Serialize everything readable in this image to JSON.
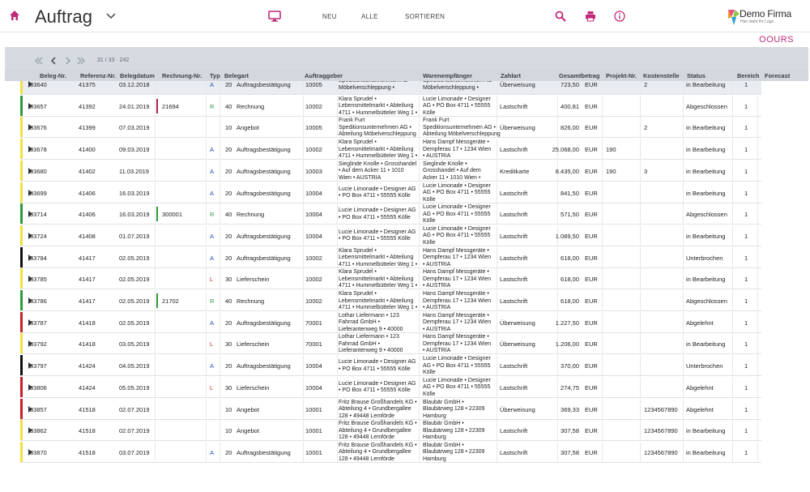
{
  "header": {
    "title": "Auftrag",
    "nav": {
      "neu": "NEU",
      "alle": "ALLE",
      "sortieren": "SORTIEREN"
    },
    "logo_name": "Demo Firma",
    "logo_tagline": "Hier steht Ihr Logo"
  },
  "brand": "OOURS",
  "pager": {
    "text": "31 / 33 · 242"
  },
  "columns": [
    "Beleg-Nr.",
    "Referenz-Nr.",
    "Belegdatum",
    "Rechnung-Nr.",
    "Typ",
    "Belegart",
    "Auftraggeber",
    "Warenempfänger",
    "Zahlart",
    "Gesamtbetrag",
    "Projekt-Nr.",
    "Kostenstelle",
    "Status",
    "Bereich",
    "Forecast"
  ],
  "colors": {
    "accent": "#c02a78",
    "blue": "#1a4fbf",
    "green": "#2e9a3a",
    "red": "#c8202a",
    "yellow": "#f0e040",
    "black": "#111111"
  },
  "rows": [
    {
      "beleg": "33640",
      "ref": "41375",
      "datum": "03.12.2018",
      "rechnung": "",
      "typ": "A",
      "nr": "20",
      "art": "Auftragsbestätigung",
      "kunde": "10005",
      "auftraggeber": [
        "Speditionsunternehmen AG •",
        "Möbelverschleppung •"
      ],
      "empf": [
        "Speditionsunternehmen AG •",
        "Möbelverschleppung •"
      ],
      "zahlart": "Überweisung",
      "betrag": "723,50",
      "waehrung": "EUR",
      "projekt": "",
      "kst": "2",
      "status": "in Bearbeitung",
      "bereich": "1",
      "bar": "yellow"
    },
    {
      "beleg": "33657",
      "ref": "41392",
      "datum": "24.01.2019",
      "rechnung": "21694",
      "typ": "R",
      "nr": "40",
      "art": "Rechnung",
      "kunde": "10002",
      "auftraggeber": [
        "Klara Sprudel •",
        "Lebensmittelmarkt • Abteilung",
        "4711 • Hummelbütteler Weg 1 •"
      ],
      "empf": [
        "Lucie Limonade • Designer",
        "AG • PO Box 4711 • 55555",
        "Kölle"
      ],
      "zahlart": "Lastschrift",
      "betrag": "400,81",
      "waehrung": "EUR",
      "projekt": "",
      "kst": "",
      "status": "Abgeschlossen",
      "bereich": "1",
      "bar": "green"
    },
    {
      "beleg": "33676",
      "ref": "41399",
      "datum": "07.03.2019",
      "rechnung": "",
      "typ": "",
      "nr": "10",
      "art": "Angebot",
      "kunde": "10005",
      "auftraggeber": [
        "Frank Furt",
        "Speditionsunternehmen AG •",
        "Abteilung Möbelverschleppung"
      ],
      "empf": [
        "Frank Furt",
        "Speditionsunternehmen AG •",
        "Abteilung Möbelverschleppung"
      ],
      "zahlart": "Überweisung",
      "betrag": "826,00",
      "waehrung": "EUR",
      "projekt": "",
      "kst": "2",
      "status": "in Bearbeitung",
      "bereich": "1",
      "bar": "yellow"
    },
    {
      "beleg": "33678",
      "ref": "41400",
      "datum": "09.03.2019",
      "rechnung": "",
      "typ": "A",
      "nr": "20",
      "art": "Auftragsbestätigung",
      "kunde": "10002",
      "auftraggeber": [
        "Klara Sprudel •",
        "Lebensmittelmarkt • Abteilung",
        "4711 • Hummelbütteler Weg 1 •"
      ],
      "empf": [
        "Hans Dampf Messgeräte •",
        "Dempferau 17 • 1234 Wien",
        "• AUSTRIA"
      ],
      "zahlart": "Lastschrift",
      "betrag": "25.068,00",
      "waehrung": "EUR",
      "projekt": "190",
      "kst": "",
      "status": "in Bearbeitung",
      "bereich": "1",
      "bar": "yellow"
    },
    {
      "beleg": "33680",
      "ref": "41402",
      "datum": "11.03.2019",
      "rechnung": "",
      "typ": "A",
      "nr": "20",
      "art": "Auftragsbestätigung",
      "kunde": "10003",
      "auftraggeber": [
        "Sieglinde Knolle • Grosshandel",
        "• Auf dem Acker 11 • 1010",
        "Wien • AUSTRIA"
      ],
      "empf": [
        "Sieglinde Knolle •",
        "Grosshandel • Auf dem",
        "Acker 11 • 1010 Wien •"
      ],
      "zahlart": "Kreditkarte",
      "betrag": "8.435,00",
      "waehrung": "EUR",
      "projekt": "190",
      "kst": "3",
      "status": "in Bearbeitung",
      "bereich": "1",
      "bar": "yellow"
    },
    {
      "beleg": "33699",
      "ref": "41406",
      "datum": "16.03.2019",
      "rechnung": "",
      "typ": "A",
      "nr": "20",
      "art": "Auftragsbestätigung",
      "kunde": "10004",
      "auftraggeber": [
        "Lucie Limonade • Designer AG",
        "• PO Box 4711 • 55555 Kölle"
      ],
      "empf": [
        "Lucie Limonade • Designer",
        "AG • PO Box 4711 • 55555",
        "Kölle"
      ],
      "zahlart": "Lastschrift",
      "betrag": "841,50",
      "waehrung": "EUR",
      "projekt": "",
      "kst": "",
      "status": "in Bearbeitung",
      "bereich": "1",
      "bar": "yellow"
    },
    {
      "beleg": "33714",
      "ref": "41406",
      "datum": "16.03.2019",
      "rechnung": "300001",
      "typ": "R",
      "nr": "40",
      "art": "Rechnung",
      "kunde": "10004",
      "auftraggeber": [
        "Lucie Limonade • Designer AG",
        "• PO Box 4711 • 55555 Kölle"
      ],
      "empf": [
        "Lucie Limonade • Designer",
        "AG • PO Box 4711 • 55555",
        "Kölle"
      ],
      "zahlart": "Lastschrift",
      "betrag": "571,50",
      "waehrung": "EUR",
      "projekt": "",
      "kst": "",
      "status": "Abgeschlossen",
      "bereich": "1",
      "bar": "green"
    },
    {
      "beleg": "33724",
      "ref": "41408",
      "datum": "01.07.2019",
      "rechnung": "",
      "typ": "A",
      "nr": "20",
      "art": "Auftragsbestätigung",
      "kunde": "10004",
      "auftraggeber": [
        "Lucie Limonade • Designer AG",
        "• PO Box 4711 • 55555 Kölle"
      ],
      "empf": [
        "Lucie Limonade • Designer",
        "AG • PO Box 4711 • 55555",
        "Kölle"
      ],
      "zahlart": "Lastschrift",
      "betrag": "1.089,50",
      "waehrung": "EUR",
      "projekt": "",
      "kst": "",
      "status": "in Bearbeitung",
      "bereich": "1",
      "bar": "yellow"
    },
    {
      "beleg": "33784",
      "ref": "41417",
      "datum": "02.05.2019",
      "rechnung": "",
      "typ": "A",
      "nr": "20",
      "art": "Auftragsbestätigung",
      "kunde": "10002",
      "auftraggeber": [
        "Klara Sprudel •",
        "Lebensmittelmarkt • Abteilung",
        "4711 • Hummelbütteler Weg 1 •"
      ],
      "empf": [
        "Hans Dampf Messgeräte •",
        "Dempferau 17 • 1234 Wien",
        "• AUSTRIA"
      ],
      "zahlart": "Lastschrift",
      "betrag": "618,00",
      "waehrung": "EUR",
      "projekt": "",
      "kst": "",
      "status": "Unterbrochen",
      "bereich": "1",
      "bar": "black"
    },
    {
      "beleg": "33785",
      "ref": "41417",
      "datum": "02.05.2019",
      "rechnung": "",
      "typ": "L",
      "nr": "30",
      "art": "Lieferschein",
      "kunde": "10002",
      "auftraggeber": [
        "Klara Sprudel •",
        "Lebensmittelmarkt • Abteilung",
        "4711 • Hummelbütteler Weg 1 •"
      ],
      "empf": [
        "Hans Dampf Messgeräte •",
        "Dempferau 17 • 1234 Wien",
        "• AUSTRIA"
      ],
      "zahlart": "Lastschrift",
      "betrag": "618,00",
      "waehrung": "EUR",
      "projekt": "",
      "kst": "",
      "status": "in Bearbeitung",
      "bereich": "1",
      "bar": "yellow"
    },
    {
      "beleg": "33786",
      "ref": "41417",
      "datum": "02.05.2019",
      "rechnung": "21702",
      "typ": "R",
      "nr": "40",
      "art": "Rechnung",
      "kunde": "10002",
      "auftraggeber": [
        "Klara Sprudel •",
        "Lebensmittelmarkt • Abteilung",
        "4711 • Hummelbütteler Weg 1 •"
      ],
      "empf": [
        "Hans Dampf Messgeräte •",
        "Dempferau 17 • 1234 Wien",
        "• AUSTRIA"
      ],
      "zahlart": "Lastschrift",
      "betrag": "618,00",
      "waehrung": "EUR",
      "projekt": "",
      "kst": "",
      "status": "Abgeschlossen",
      "bereich": "1",
      "bar": "green"
    },
    {
      "beleg": "33787",
      "ref": "41418",
      "datum": "02.05.2019",
      "rechnung": "",
      "typ": "A",
      "nr": "20",
      "art": "Auftragsbestätigung",
      "kunde": "70001",
      "auftraggeber": [
        "Lothar Liefermann • 123",
        "Fahrrad GmbH •",
        "Lieferantenweg 9 • 40000"
      ],
      "empf": [
        "Hans Dampf Messgeräte •",
        "Dempferau 17 • 1234 Wien",
        "• AUSTRIA"
      ],
      "zahlart": "Überweisung",
      "betrag": "1.227,50",
      "waehrung": "EUR",
      "projekt": "",
      "kst": "",
      "status": "Abgelehnt",
      "bereich": "1",
      "bar": "red"
    },
    {
      "beleg": "33792",
      "ref": "41418",
      "datum": "03.05.2019",
      "rechnung": "",
      "typ": "L",
      "nr": "30",
      "art": "Lieferschein",
      "kunde": "70001",
      "auftraggeber": [
        "Lothar Liefermann • 123",
        "Fahrrad GmbH •",
        "Lieferantenweg 9 • 40000"
      ],
      "empf": [
        "Hans Dampf Messgeräte •",
        "Dempferau 17 • 1234 Wien",
        "• AUSTRIA"
      ],
      "zahlart": "Überweisung",
      "betrag": "1.206,00",
      "waehrung": "EUR",
      "projekt": "",
      "kst": "",
      "status": "in Bearbeitung",
      "bereich": "1",
      "bar": "yellow"
    },
    {
      "beleg": "33797",
      "ref": "41424",
      "datum": "04.05.2019",
      "rechnung": "",
      "typ": "A",
      "nr": "20",
      "art": "Auftragsbestätigung",
      "kunde": "10004",
      "auftraggeber": [
        "Lucie Limonade • Designer AG",
        "• PO Box 4711 • 55555 Kölle"
      ],
      "empf": [
        "Lucie Limonade • Designer",
        "AG • PO Box 4711 • 55555",
        "Kölle"
      ],
      "zahlart": "Lastschrift",
      "betrag": "370,00",
      "waehrung": "EUR",
      "projekt": "",
      "kst": "",
      "status": "Unterbrochen",
      "bereich": "1",
      "bar": "black"
    },
    {
      "beleg": "33806",
      "ref": "41424",
      "datum": "05.05.2019",
      "rechnung": "",
      "typ": "L",
      "nr": "30",
      "art": "Lieferschein",
      "kunde": "10004",
      "auftraggeber": [
        "Lucie Limonade • Designer AG",
        "• PO Box 4711 • 55555 Kölle"
      ],
      "empf": [
        "Lucie Limonade • Designer",
        "AG • PO Box 4711 • 55555",
        "Kölle"
      ],
      "zahlart": "Lastschrift",
      "betrag": "274,75",
      "waehrung": "EUR",
      "projekt": "",
      "kst": "",
      "status": "Abgelehnt",
      "bereich": "1",
      "bar": "red"
    },
    {
      "beleg": "33857",
      "ref": "41518",
      "datum": "02.07.2019",
      "rechnung": "",
      "typ": "",
      "nr": "10",
      "art": "Angebot",
      "kunde": "10001",
      "auftraggeber": [
        "Fritz Brause Großhandels KG •",
        "Abteilung 4 • Grundbergallee",
        "128 • 49448 Lemförde"
      ],
      "empf": [
        "Blaubär GmbH •",
        "Blaubärweg 128 • 22309",
        "Hamburg"
      ],
      "zahlart": "Überweisung",
      "betrag": "369,33",
      "waehrung": "EUR",
      "projekt": "",
      "kst": "1234567890",
      "status": "Abgelehnt",
      "bereich": "1",
      "bar": "red"
    },
    {
      "beleg": "33862",
      "ref": "41518",
      "datum": "02.07.2019",
      "rechnung": "",
      "typ": "",
      "nr": "10",
      "art": "Angebot",
      "kunde": "10001",
      "auftraggeber": [
        "Fritz Brause Großhandels KG •",
        "Abteilung 4 • Grundbergallee",
        "128 • 49448 Lemförde"
      ],
      "empf": [
        "Blaubär GmbH •",
        "Blaubärweg 128 • 22309",
        "Hamburg"
      ],
      "zahlart": "Lastschrift",
      "betrag": "307,58",
      "waehrung": "EUR",
      "projekt": "",
      "kst": "1234567890",
      "status": "in Bearbeitung",
      "bereich": "1",
      "bar": "yellow"
    },
    {
      "beleg": "33870",
      "ref": "41518",
      "datum": "03.07.2019",
      "rechnung": "",
      "typ": "A",
      "nr": "20",
      "art": "Auftragsbestätigung",
      "kunde": "10001",
      "auftraggeber": [
        "Fritz Brause Großhandels KG •",
        "Abteilung 4 • Grundbergallee",
        "128 • 49448 Lemförde"
      ],
      "empf": [
        "Blaubär GmbH •",
        "Blaubärweg 128 • 22309",
        "Hamburg"
      ],
      "zahlart": "Lastschrift",
      "betrag": "307,58",
      "waehrung": "EUR",
      "projekt": "",
      "kst": "1234567890",
      "status": "in Bearbeitung",
      "bereich": "1",
      "bar": "yellow"
    }
  ]
}
